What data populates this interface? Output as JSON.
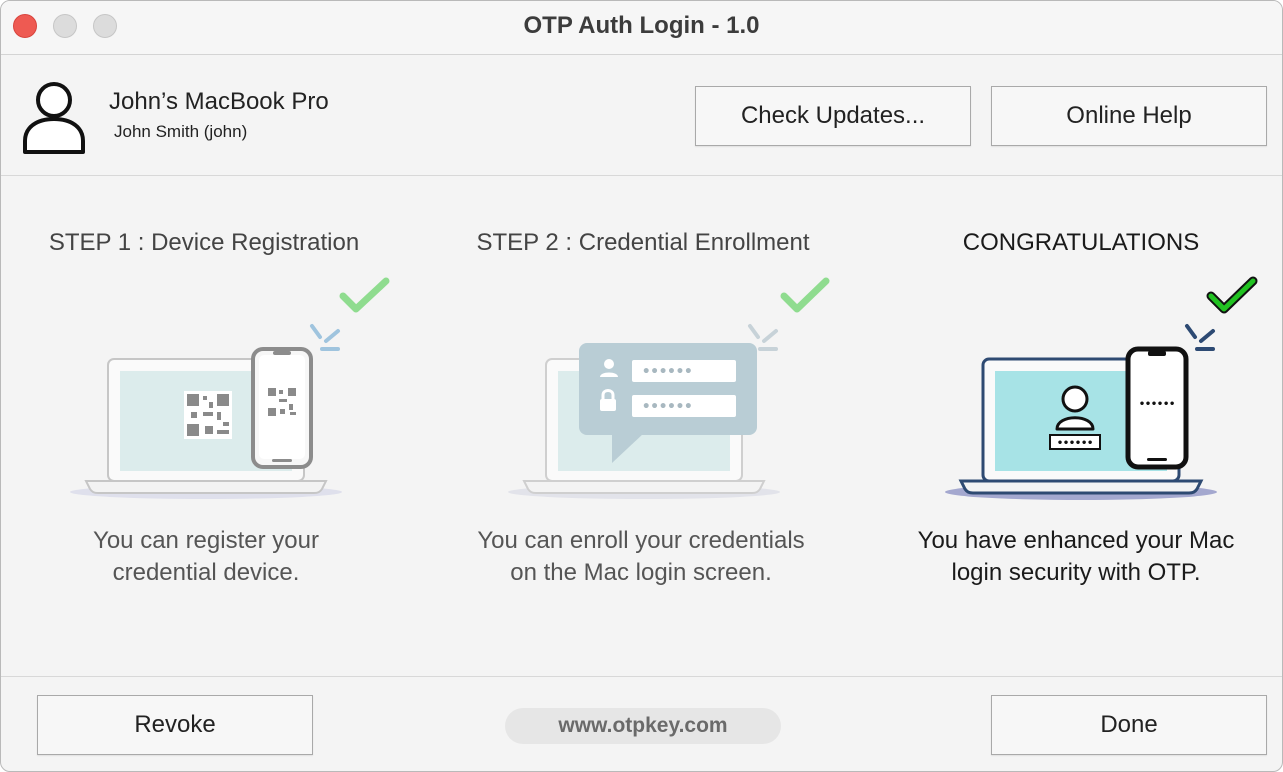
{
  "window": {
    "title": "OTP Auth Login - 1.0"
  },
  "header": {
    "device_name": "John’s MacBook Pro",
    "user_name": "John Smith (john)",
    "check_updates_label": "Check Updates...",
    "online_help_label": "Online Help"
  },
  "steps": [
    {
      "title": "STEP 1 : Device Registration",
      "description": "You can register your credential device.",
      "completed": true,
      "icon": "laptop-qr-phone-illustration"
    },
    {
      "title": "STEP 2 : Credential Enrollment",
      "description": "You can enroll your credentials on the Mac login screen.",
      "completed": true,
      "icon": "laptop-credentials-bubble-illustration"
    },
    {
      "title": "CONGRATULATIONS",
      "description": "You have enhanced your Mac login security with OTP.",
      "completed": true,
      "icon": "laptop-login-phone-illustration"
    }
  ],
  "footer": {
    "revoke_label": "Revoke",
    "website": "www.otpkey.com",
    "done_label": "Done"
  },
  "colors": {
    "check_faded": "#8fdc8f",
    "check_active": "#22c322",
    "screen_faded": "#dcecec",
    "screen_active": "#a7e3e6",
    "close_button": "#ee5a52"
  }
}
